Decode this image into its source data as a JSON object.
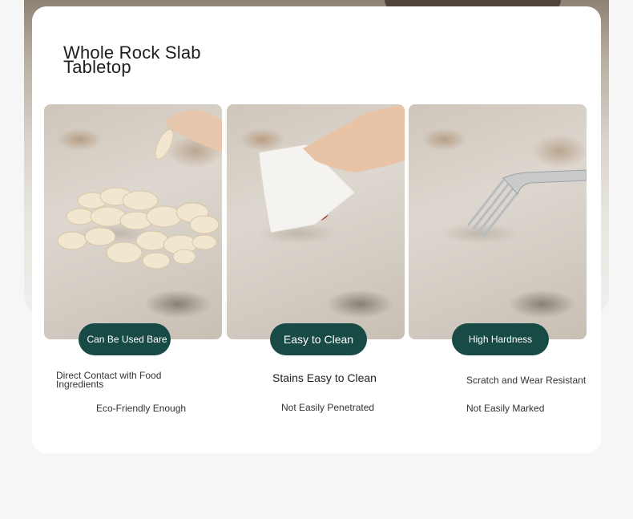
{
  "title_line1": "Whole Rock Slab",
  "title_line2": "Tabletop",
  "panels": [
    {
      "icon": "chips-icon",
      "badge": "Can Be Used Bare",
      "features": [
        "Direct Contact with Food Ingredients",
        "Eco-Friendly Enough"
      ]
    },
    {
      "icon": "napkin-icon",
      "badge": "Easy to Clean",
      "features": [
        "Stains Easy to Clean",
        "Not Easily Penetrated"
      ]
    },
    {
      "icon": "fork-icon",
      "badge": "High Hardness",
      "features": [
        "Scratch and Wear Resistant",
        "Not Easily Marked"
      ]
    }
  ],
  "colors": {
    "badge_bg": "#184b45",
    "badge_text": "#ffffff",
    "card_bg": "#ffffff",
    "page_bg": "#f6f6f6"
  }
}
